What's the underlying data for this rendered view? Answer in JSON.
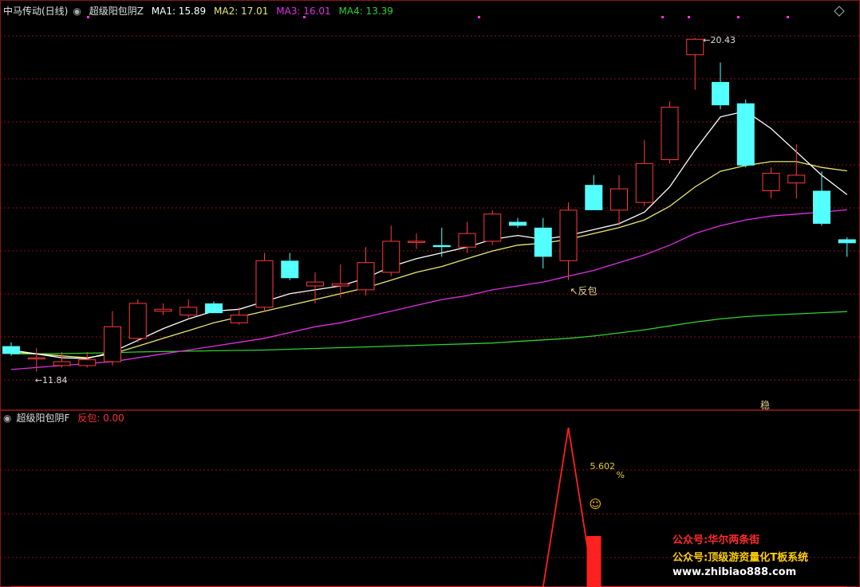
{
  "header_top": {
    "stock": "中马传动(日线)",
    "indicator": "超级阳包阴Z",
    "ma1": "MA1: 15.89",
    "ma2": "MA2: 17.01",
    "ma3": "MA3: 16.01",
    "ma4": "MA4: 13.39"
  },
  "header_bottom": {
    "indicator": "超级阳包阴F",
    "signal": "反包: 0.00"
  },
  "annotations": {
    "high_label": "20.43",
    "low_label": "11.84",
    "signal_label": "反包",
    "extra_tag": "稳",
    "percent_value": "5.602",
    "percent_sign": "%",
    "smiley": "☺"
  },
  "watermark": {
    "line1": "公众号:华尔两条街",
    "line2": "公众号:顶级游资量化T板系统",
    "line3": "www.zhibiao888.com"
  },
  "colors": {
    "up": "#ff3b3b",
    "down": "#54ffff",
    "ma1": "#ffffff",
    "ma2": "#e8e870",
    "ma3": "#e030e0",
    "ma4": "#30d030",
    "grid": "#8a1515",
    "signal": "#ff2020",
    "percent_text": "#e8d020"
  },
  "chart_data": {
    "type": "candlestick",
    "price_range": [
      11.2,
      21.0
    ],
    "candles": [
      {
        "o": 12.5,
        "h": 12.6,
        "l": 12.25,
        "c": 12.3
      },
      {
        "o": 12.2,
        "h": 12.45,
        "l": 11.84,
        "c": 12.2
      },
      {
        "o": 12.0,
        "h": 12.35,
        "l": 11.95,
        "c": 12.1
      },
      {
        "o": 12.0,
        "h": 12.35,
        "l": 11.95,
        "c": 12.15
      },
      {
        "o": 12.1,
        "h": 13.4,
        "l": 12.0,
        "c": 13.0
      },
      {
        "o": 12.7,
        "h": 13.7,
        "l": 12.6,
        "c": 13.6
      },
      {
        "o": 13.4,
        "h": 13.6,
        "l": 13.3,
        "c": 13.45
      },
      {
        "o": 13.3,
        "h": 13.7,
        "l": 13.2,
        "c": 13.5
      },
      {
        "o": 13.6,
        "h": 13.65,
        "l": 13.35,
        "c": 13.35
      },
      {
        "o": 13.1,
        "h": 13.5,
        "l": 13.05,
        "c": 13.3
      },
      {
        "o": 13.5,
        "h": 14.9,
        "l": 13.4,
        "c": 14.7
      },
      {
        "o": 14.7,
        "h": 14.9,
        "l": 14.2,
        "c": 14.25
      },
      {
        "o": 14.05,
        "h": 14.4,
        "l": 13.6,
        "c": 14.15
      },
      {
        "o": 14.05,
        "h": 14.6,
        "l": 13.75,
        "c": 14.1
      },
      {
        "o": 13.95,
        "h": 15.05,
        "l": 13.8,
        "c": 14.65
      },
      {
        "o": 14.4,
        "h": 15.6,
        "l": 14.3,
        "c": 15.2
      },
      {
        "o": 15.2,
        "h": 15.4,
        "l": 15.0,
        "c": 15.2
      },
      {
        "o": 15.1,
        "h": 15.55,
        "l": 14.8,
        "c": 15.05
      },
      {
        "o": 15.05,
        "h": 15.7,
        "l": 14.9,
        "c": 15.4
      },
      {
        "o": 15.2,
        "h": 16.0,
        "l": 15.1,
        "c": 15.9
      },
      {
        "o": 15.7,
        "h": 15.8,
        "l": 15.55,
        "c": 15.6
      },
      {
        "o": 15.55,
        "h": 15.8,
        "l": 14.5,
        "c": 14.8
      },
      {
        "o": 14.7,
        "h": 16.2,
        "l": 14.2,
        "c": 16.0
      },
      {
        "o": 16.65,
        "h": 16.9,
        "l": 16.0,
        "c": 16.0
      },
      {
        "o": 16.0,
        "h": 16.9,
        "l": 15.6,
        "c": 16.55
      },
      {
        "o": 16.2,
        "h": 17.8,
        "l": 16.1,
        "c": 17.2
      },
      {
        "o": 17.3,
        "h": 18.8,
        "l": 17.2,
        "c": 18.65
      },
      {
        "o": 20.0,
        "h": 20.43,
        "l": 19.1,
        "c": 20.4
      },
      {
        "o": 19.3,
        "h": 19.8,
        "l": 18.6,
        "c": 18.7
      },
      {
        "o": 18.75,
        "h": 18.85,
        "l": 17.1,
        "c": 17.15
      },
      {
        "o": 16.5,
        "h": 17.1,
        "l": 16.3,
        "c": 16.95
      },
      {
        "o": 16.7,
        "h": 17.7,
        "l": 16.3,
        "c": 16.9
      },
      {
        "o": 16.5,
        "h": 17.0,
        "l": 15.6,
        "c": 15.65
      },
      {
        "o": 15.25,
        "h": 15.3,
        "l": 14.8,
        "c": 15.15
      }
    ],
    "ma1": [
      12.4,
      12.3,
      12.2,
      12.18,
      12.35,
      12.65,
      12.95,
      13.2,
      13.4,
      13.45,
      13.65,
      13.85,
      13.95,
      14.05,
      14.25,
      14.55,
      14.75,
      14.9,
      15.05,
      15.25,
      15.35,
      15.25,
      15.35,
      15.5,
      15.65,
      15.95,
      16.6,
      17.55,
      18.4,
      18.55,
      18.1,
      17.5,
      16.9,
      16.4
    ],
    "ma2": [
      12.35,
      12.3,
      12.25,
      12.2,
      12.3,
      12.5,
      12.7,
      12.9,
      13.1,
      13.25,
      13.4,
      13.55,
      13.7,
      13.85,
      14.0,
      14.2,
      14.4,
      14.55,
      14.75,
      14.95,
      15.1,
      15.15,
      15.25,
      15.4,
      15.55,
      15.75,
      16.1,
      16.6,
      17.0,
      17.15,
      17.25,
      17.25,
      17.1,
      17.01
    ],
    "ma3": [
      11.9,
      11.95,
      12.0,
      12.05,
      12.1,
      12.2,
      12.3,
      12.4,
      12.5,
      12.6,
      12.7,
      12.85,
      13.0,
      13.1,
      13.25,
      13.4,
      13.55,
      13.7,
      13.8,
      13.95,
      14.05,
      14.15,
      14.3,
      14.45,
      14.65,
      14.85,
      15.1,
      15.4,
      15.6,
      15.75,
      15.85,
      15.9,
      15.95,
      16.01
    ],
    "ma4": [
      12.3,
      12.3,
      12.31,
      12.32,
      12.33,
      12.35,
      12.36,
      12.37,
      12.38,
      12.39,
      12.4,
      12.42,
      12.44,
      12.46,
      12.48,
      12.5,
      12.52,
      12.54,
      12.56,
      12.58,
      12.62,
      12.66,
      12.7,
      12.76,
      12.84,
      12.92,
      13.02,
      13.12,
      13.2,
      13.26,
      13.3,
      13.33,
      13.36,
      13.39
    ],
    "signal": {
      "values": [
        0,
        0,
        0,
        0,
        0,
        0,
        0,
        0,
        0,
        0,
        0,
        0,
        0,
        0,
        0,
        0,
        0,
        0,
        0,
        0,
        0,
        0,
        1,
        0,
        0,
        0,
        0,
        0,
        0,
        0,
        0,
        0,
        0,
        0
      ],
      "bar_index": 22,
      "bar_value": 5.602
    }
  }
}
